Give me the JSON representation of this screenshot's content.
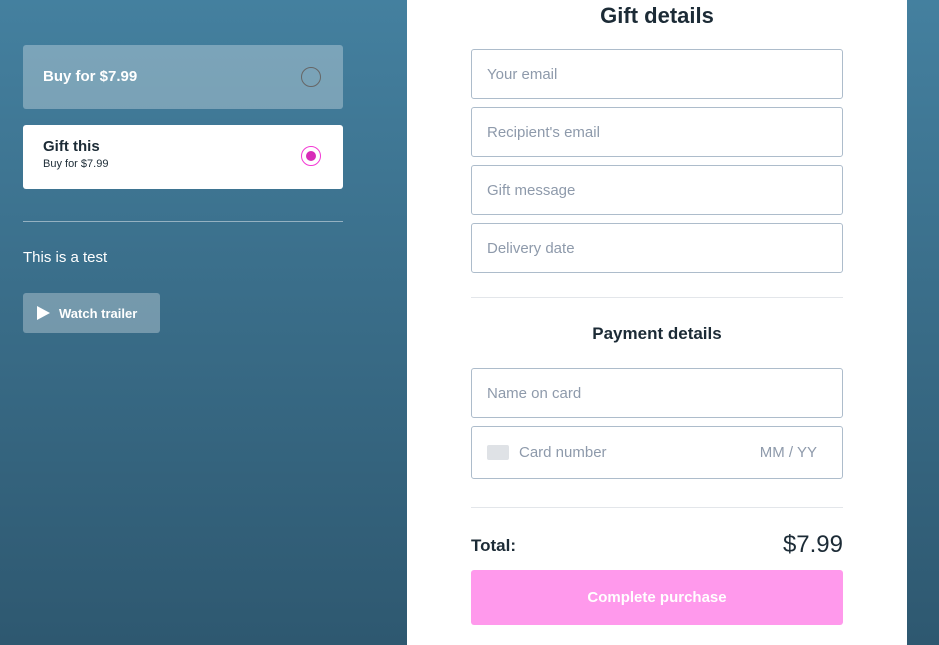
{
  "options": [
    {
      "label": "Buy for $7.99",
      "selected": false
    },
    {
      "label": "Gift this",
      "sublabel": "Buy for $7.99",
      "selected": true
    }
  ],
  "description": "This is a test",
  "trailer_label": "Watch trailer",
  "gift": {
    "title": "Gift details",
    "fields": [
      "Your email",
      "Recipient's email",
      "Gift message",
      "Delivery date"
    ]
  },
  "payment": {
    "title": "Payment details",
    "name_placeholder": "Name on card",
    "card_placeholder": "Card number",
    "expiry_placeholder": "MM / YY"
  },
  "total_label": "Total:",
  "total_value": "$7.99",
  "purchase_label": "Complete purchase",
  "colors": {
    "accent": "#ff99ec",
    "radio": "#d82cb8"
  }
}
